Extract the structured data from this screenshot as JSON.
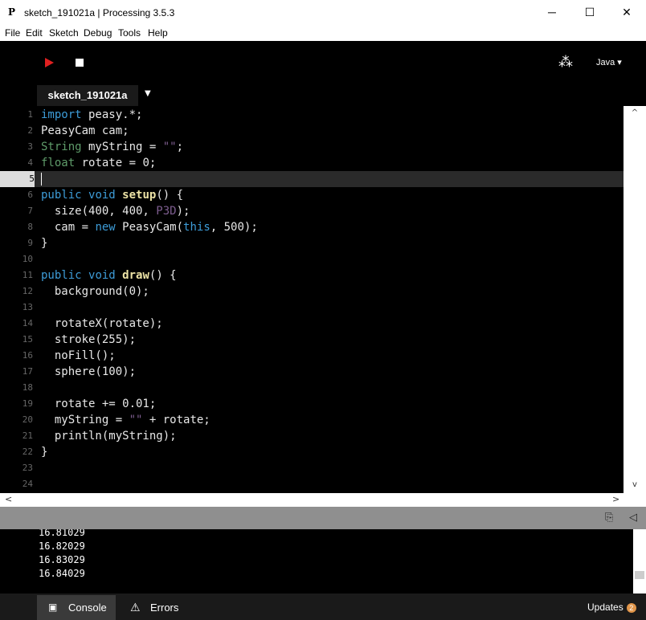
{
  "window": {
    "icon": "P",
    "title": "sketch_191021a | Processing 3.5.3",
    "minimize": "─",
    "maximize": "☐",
    "close": "✕"
  },
  "menu": [
    "File",
    "Edit",
    "Sketch",
    "Debug",
    "Tools",
    "Help"
  ],
  "toolbar": {
    "mode": "Java ▾",
    "debug_icon": "⁂"
  },
  "editor": {
    "tab": "sketch_191021a",
    "tab_menu": "▼",
    "current_line": 5,
    "lines": [
      "import peasy.*;",
      "PeasyCam cam;",
      "String myString = \"\";",
      "float rotate = 0;",
      "",
      "public void setup() {",
      "  size(400, 400, P3D);",
      "  cam = new PeasyCam(this, 500);",
      "}",
      "",
      "public void draw() {",
      "  background(0);",
      "",
      "  rotateX(rotate);",
      "  stroke(255);",
      "  noFill();",
      "  sphere(100);",
      "",
      "  rotate += 0.01;",
      "  myString = \"\" + rotate;",
      "  println(myString);",
      "}",
      "",
      ""
    ]
  },
  "scrollbars": {
    "up": "^",
    "down": "v",
    "left": "<",
    "right": ">"
  },
  "console": {
    "copy_icon": "⎘",
    "collapse_icon": "◁",
    "lines": [
      "16.81029",
      "16.82029",
      "16.83029",
      "16.84029"
    ]
  },
  "footer": {
    "console_tab": "Console",
    "errors_tab": "Errors",
    "updates": "Updates",
    "updates_count": "2"
  }
}
